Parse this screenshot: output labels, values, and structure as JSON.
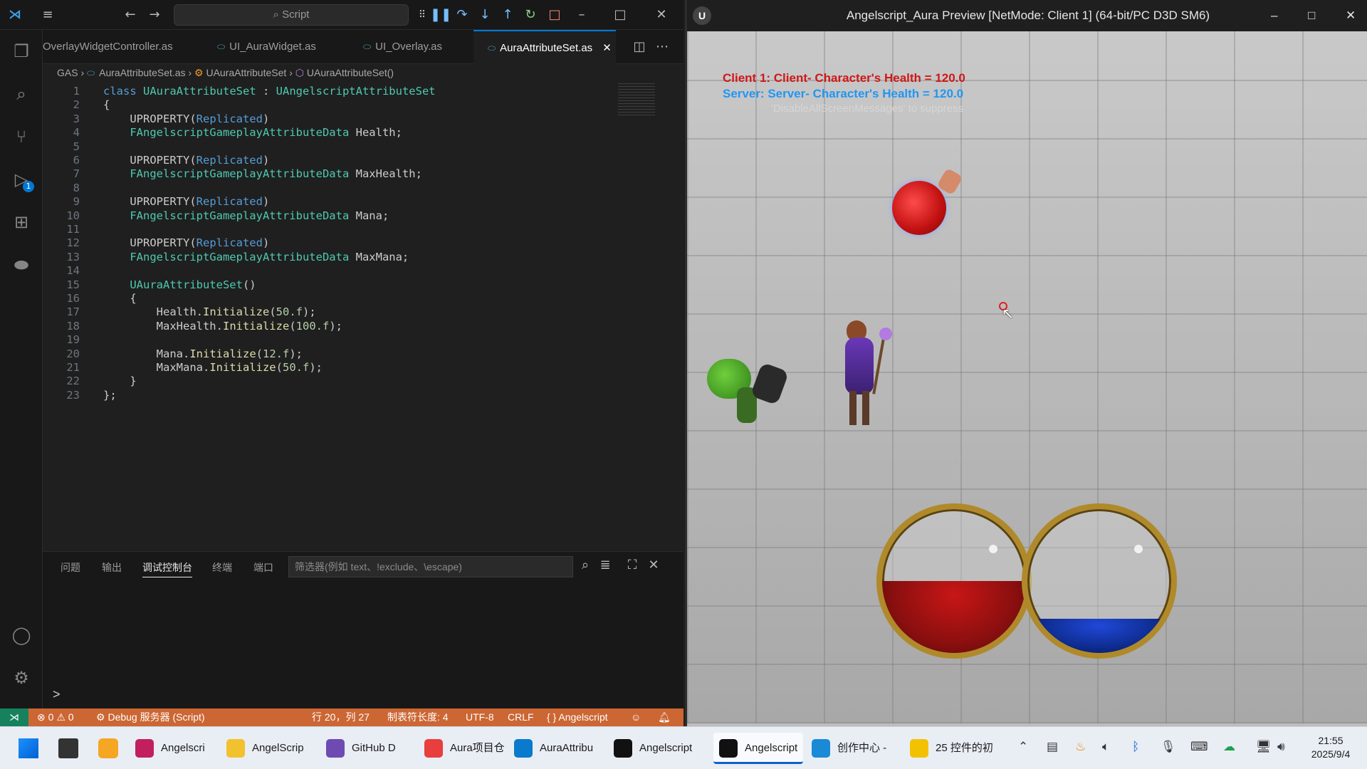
{
  "vscode": {
    "command_center": "Script",
    "tabs": [
      {
        "label": "OverlayWidgetController.as"
      },
      {
        "label": "UI_AuraWidget.as"
      },
      {
        "label": "UI_Overlay.as"
      },
      {
        "label": "AuraAttributeSet.as"
      }
    ],
    "breadcrumb": [
      "GAS",
      "AuraAttributeSet.as",
      "UAuraAttributeSet",
      "UAuraAttributeSet()"
    ],
    "code_lines": [
      "class UAuraAttributeSet : UAngelscriptAttributeSet",
      "{",
      "    UPROPERTY(Replicated)",
      "    FAngelscriptGameplayAttributeData Health;",
      "",
      "    UPROPERTY(Replicated)",
      "    FAngelscriptGameplayAttributeData MaxHealth;",
      "",
      "    UPROPERTY(Replicated)",
      "    FAngelscriptGameplayAttributeData Mana;",
      "",
      "    UPROPERTY(Replicated)",
      "    FAngelscriptGameplayAttributeData MaxMana;",
      "",
      "    UAuraAttributeSet()",
      "    {",
      "        Health.Initialize(50.f);",
      "        MaxHealth.Initialize(100.f);",
      "",
      "        Mana.Initialize(12.f);",
      "        MaxMana.Initialize(50.f);",
      "    }",
      "};"
    ],
    "panel_tabs": [
      "问题",
      "输出",
      "调试控制台",
      "终端",
      "端口"
    ],
    "panel_active_tab": "调试控制台",
    "panel_filter_placeholder": "筛选器(例如 text、!exclude、\\escape)",
    "panel_prompt": ">",
    "status": {
      "errors": "0",
      "warnings": "0",
      "debug": "Debug 服务器 (Script)",
      "position": "行 20，列 27",
      "tab_size": "制表符长度: 4",
      "encoding": "UTF-8",
      "eol": "CRLF",
      "language": "Angelscript"
    },
    "activity_badge": "1"
  },
  "game": {
    "title": "Angelscript_Aura Preview [NetMode: Client 1]  (64-bit/PC D3D SM6)",
    "debug_client": "Client 1: Client- Character's Health = 120.0",
    "debug_server": "Server: Server- Character's Health = 120.0",
    "debug_hint": "'DisableAllScreenMessages' to suppress",
    "health_fill": 0.5,
    "mana_fill": 0.24,
    "colors": {
      "health": "#8a0f0f",
      "mana": "#0d2a8a",
      "client_text": "#d01818",
      "server_text": "#2196f3"
    }
  },
  "taskbar": {
    "items": [
      {
        "label": "Angelscri",
        "icon": "rider-icon"
      },
      {
        "label": "AngelScrip",
        "icon": "folder-icon"
      },
      {
        "label": "GitHub D",
        "icon": "github-desktop-icon"
      },
      {
        "label": "Aura项目仓",
        "icon": "xmind-icon"
      },
      {
        "label": "AuraAttribu",
        "icon": "vscode-icon"
      },
      {
        "label": "Angelscript",
        "icon": "unreal-icon"
      },
      {
        "label": "Angelscript",
        "icon": "unreal-icon"
      },
      {
        "label": "创作中心 -",
        "icon": "edge-icon"
      },
      {
        "label": "25 控件的初",
        "icon": "potplayer-icon"
      }
    ],
    "time": "21:55",
    "date": "2025/9/4"
  }
}
